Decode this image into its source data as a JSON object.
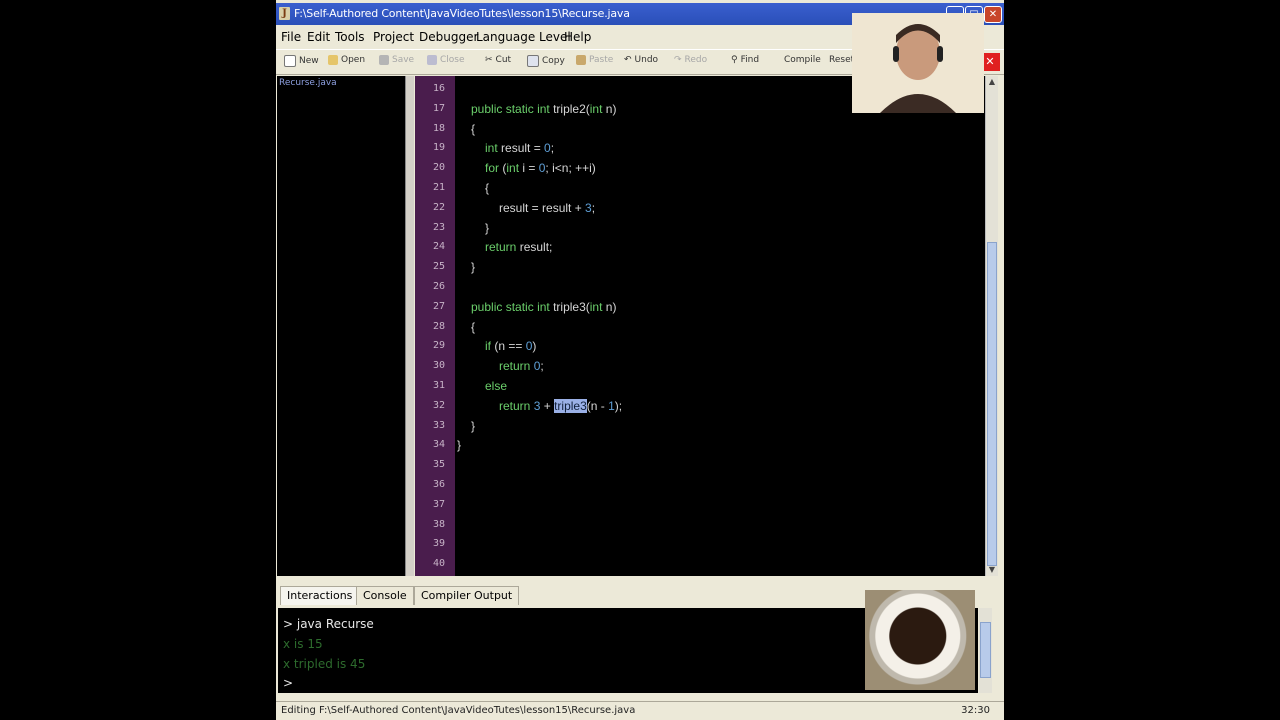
{
  "window": {
    "title": "F:\\Self-Authored Content\\JavaVideoTutes\\lesson15\\Recurse.java"
  },
  "menu": [
    "File",
    "Edit",
    "Tools",
    "Project",
    "Debugger",
    "Language Level",
    "Help"
  ],
  "toolbar": [
    "New",
    "Open",
    "Save",
    "Close",
    "Cut",
    "Copy",
    "Paste",
    "Undo",
    "Redo",
    "Find",
    "Compile",
    "Reset"
  ],
  "files": [
    "Recurse.java"
  ],
  "code": {
    "lines": [
      {
        "n": "16",
        "text": ""
      },
      {
        "n": "17",
        "text": "public static int triple2(int n)"
      },
      {
        "n": "18",
        "text": "{"
      },
      {
        "n": "19",
        "text": "int result = 0;"
      },
      {
        "n": "20",
        "text": "for (int i = 0; i<n; ++i)"
      },
      {
        "n": "21",
        "text": "{"
      },
      {
        "n": "22",
        "text": "result = result + 3;"
      },
      {
        "n": "23",
        "text": "}"
      },
      {
        "n": "24",
        "text": "return result;"
      },
      {
        "n": "25",
        "text": "}"
      },
      {
        "n": "26",
        "text": ""
      },
      {
        "n": "27",
        "text": "public static int triple3(int n)"
      },
      {
        "n": "28",
        "text": "{"
      },
      {
        "n": "29",
        "text": "if (n == 0)"
      },
      {
        "n": "30",
        "text": "return 0;"
      },
      {
        "n": "31",
        "text": "else"
      },
      {
        "n": "32",
        "text": "return 3 + triple3(n - 1);"
      },
      {
        "n": "33",
        "text": "}"
      },
      {
        "n": "34",
        "text": "}"
      },
      {
        "n": "35",
        "text": ""
      },
      {
        "n": "36",
        "text": ""
      },
      {
        "n": "37",
        "text": ""
      },
      {
        "n": "38",
        "text": ""
      },
      {
        "n": "39",
        "text": ""
      },
      {
        "n": "40",
        "text": ""
      }
    ],
    "selection": "triple3"
  },
  "tabs": [
    "Interactions",
    "Console",
    "Compiler Output"
  ],
  "console": [
    "> java Recurse",
    "x is 15",
    "x tripled is 45",
    ">"
  ],
  "status": {
    "left": "Editing F:\\Self-Authored Content\\JavaVideoTutes\\lesson15\\Recurse.java",
    "position": "32:30"
  },
  "colors": {
    "keyword": "#6bcf6b",
    "number": "#5f9fd6",
    "gutter": "#4a1d4d",
    "selection": "#9ab0e6"
  }
}
